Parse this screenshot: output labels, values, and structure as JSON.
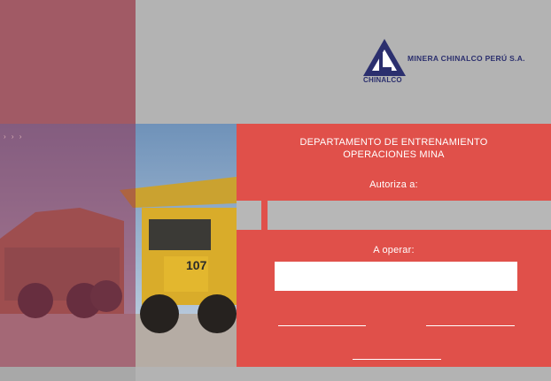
{
  "logo": {
    "company_name": "MINERA CHINALCO PERÚ S.A.",
    "brand": "CHINALCO",
    "color": "#2b2f6e"
  },
  "card": {
    "department_line1": "DEPARTAMENTO DE ENTRENAMIENTO",
    "department_line2": "OPERACIONES MINA",
    "authorizes_label": "Autoriza a:",
    "operate_label": "A operar:",
    "authorized_value": "",
    "operate_value": ""
  },
  "decor": {
    "chevrons": "› › ›",
    "truck_number": "107"
  },
  "colors": {
    "panel_red": "#e0504a",
    "maroon": "#a15a65",
    "gray": "#b3b3b3"
  }
}
